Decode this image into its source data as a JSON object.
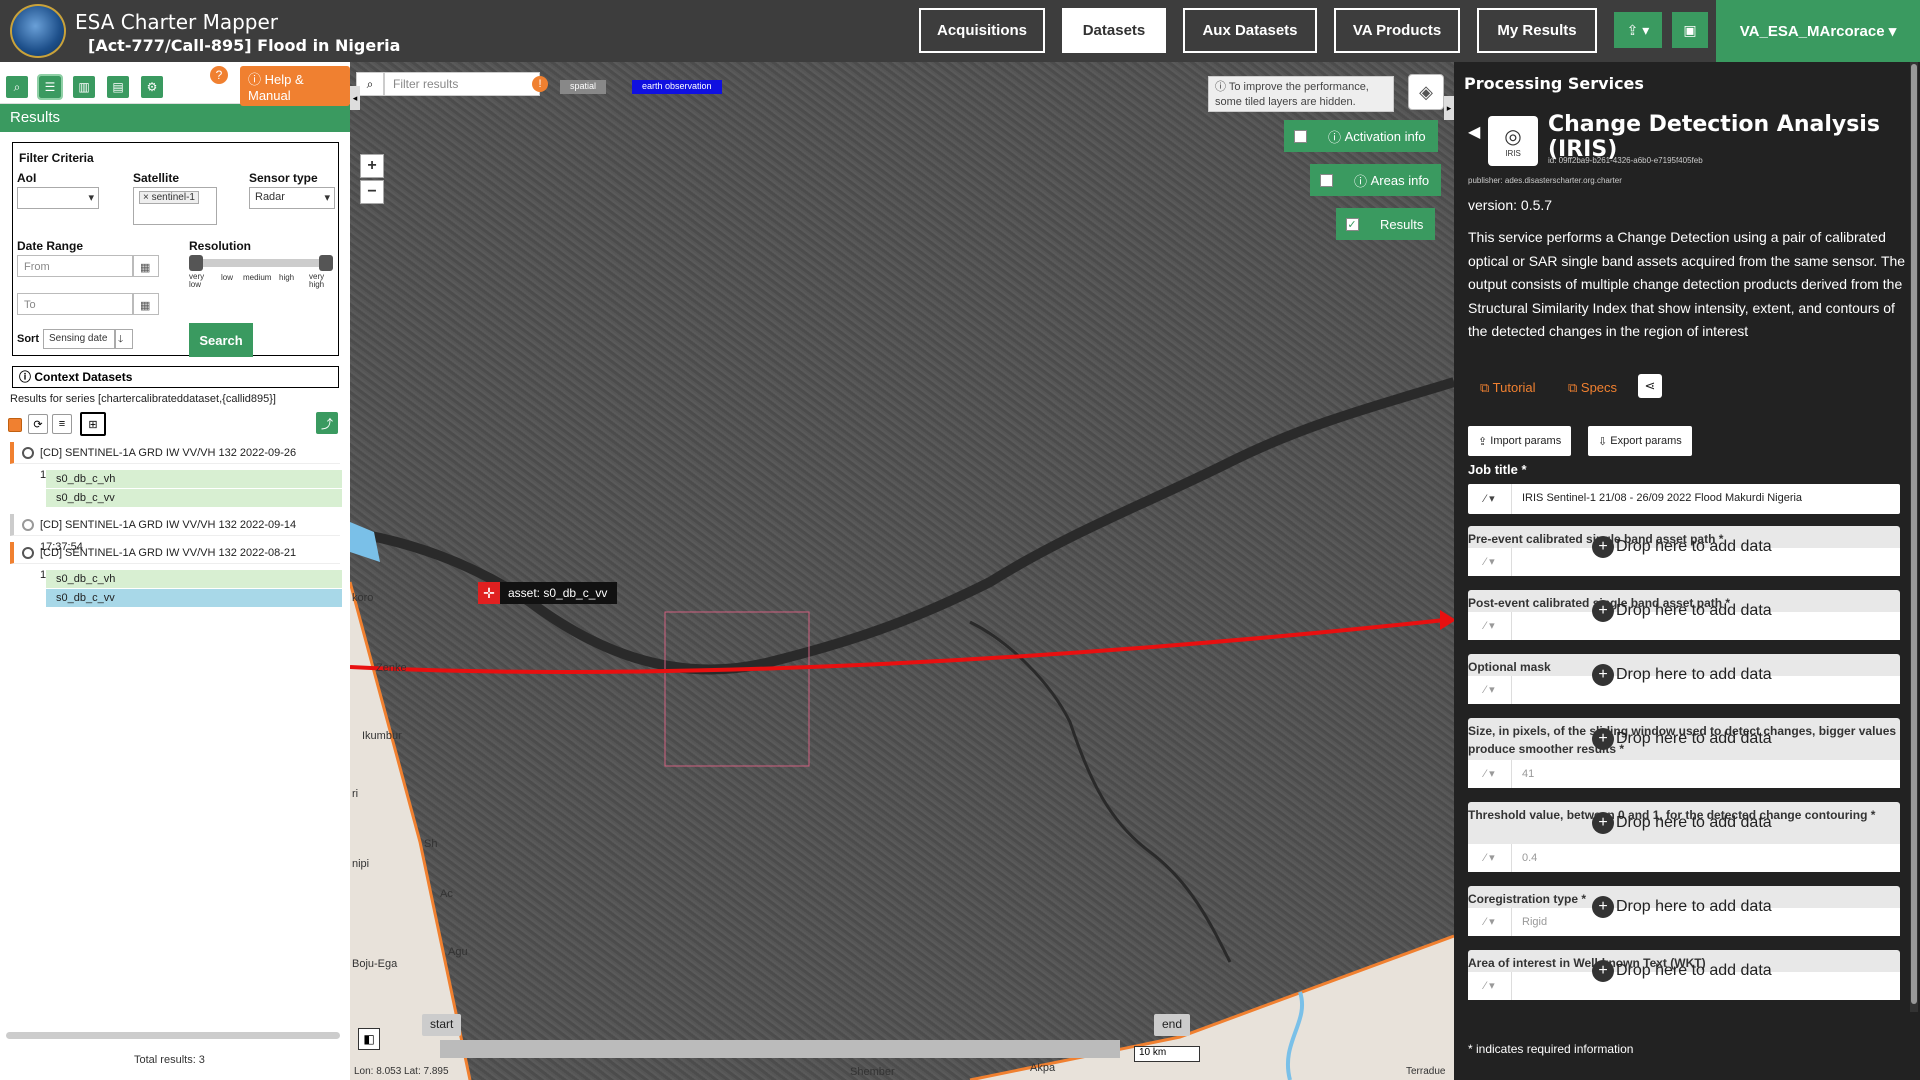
{
  "header": {
    "app_title": "ESA Charter Mapper",
    "activation": "[Act-777/Call-895] Flood in Nigeria",
    "nav": [
      "Acquisitions",
      "Datasets",
      "Aux Datasets",
      "VA Products",
      "My Results"
    ],
    "user": "VA_ESA_MArcorace"
  },
  "left": {
    "help": "Help & Manual",
    "help_q": "?",
    "results_title": "Results",
    "filter": {
      "title": "Filter Criteria",
      "aoi_label": "AoI",
      "satellite_label": "Satellite",
      "satellite_value": "sentinel-1",
      "sensor_label": "Sensor type",
      "sensor_value": "Radar",
      "date_label": "Date Range",
      "from_ph": "From",
      "to_ph": "To",
      "resolution_label": "Resolution",
      "res_ticks": [
        "very low",
        "low",
        "medium",
        "high",
        "very high"
      ],
      "sort_label": "Sort",
      "sort_value": "Sensing date",
      "search": "Search"
    },
    "context": "Context Datasets",
    "series": "Results for series [chartercalibrateddataset,{callid895}]",
    "items": [
      {
        "title": "[CD] SENTINEL-1A GRD IW VV/VH 132 2022-09-26 17:37:54",
        "subs": [
          "s0_db_c_vh",
          "s0_db_c_vv"
        ]
      },
      {
        "title": "[CD] SENTINEL-1A GRD IW VV/VH 132 2022-09-14 17:37:54",
        "subs": []
      },
      {
        "title": "[CD] SENTINEL-1A GRD IW VV/VH 132 2022-08-21 17:37:53",
        "subs": [
          "s0_db_c_vh",
          "s0_db_c_vv"
        ]
      }
    ],
    "total": "Total results: 3"
  },
  "map": {
    "filter_ph": "Filter results",
    "tag_spatial": "spatial",
    "tag_eo": "earth observation",
    "tooltip": "To improve the performance, some tiled layers are hidden.",
    "activation_info": "Activation info",
    "areas_info": "Areas info",
    "results": "Results",
    "asset_label": "asset: s0_db_c_vv",
    "places": [
      "Zenke",
      "Ikumbur",
      "Boju-Ega",
      "Shember",
      "Akpa",
      "koro",
      "Sh",
      "Ac",
      "Agu",
      "nipi",
      "ri"
    ],
    "start": "start",
    "end": "end",
    "scale": "10 km",
    "coords": "Lon: 8.053 Lat: 7.895",
    "attribution": "Terradue"
  },
  "processing": {
    "panel_title": "Processing Services",
    "service_title": "Change Detection Analysis (IRIS)",
    "icon_label": "IRIS",
    "id": "id: 09ff2ba9-b261-4326-a6b0-e7195f405feb",
    "publisher": "publisher: ades.disasterscharter.org.charter",
    "version": "version: 0.5.7",
    "description": "This service performs a Change Detection using a pair of calibrated optical or SAR single band assets acquired from the same sensor. The output consists of multiple change detection products derived from the Structural Similarity Index that show intensity, extent, and contours of the detected changes in the region of interest",
    "tutorial": "Tutorial",
    "specs": "Specs",
    "import": "Import params",
    "export": "Export params",
    "job_label": "Job title *",
    "job_value": "IRIS Sentinel-1 21/08 - 26/09 2022 Flood Makurdi Nigeria",
    "drop_text": "Drop here to add data",
    "params": [
      {
        "label": "Pre-event calibrated single band asset path *",
        "value": ""
      },
      {
        "label": "Post-event calibrated single band asset path *",
        "value": ""
      },
      {
        "label": "Optional mask",
        "value": ""
      },
      {
        "label": "Size, in pixels, of the sliding window used to detect changes, bigger values produce smoother results *",
        "value": "41"
      },
      {
        "label": "Threshold value, between 0 and 1, for the detected change contouring *",
        "value": "0.4"
      },
      {
        "label": "Coregistration type *",
        "value": "Rigid"
      },
      {
        "label": "Area of interest in Well-known Text (WKT)",
        "value": ""
      }
    ],
    "required_note": "* indicates required information"
  }
}
